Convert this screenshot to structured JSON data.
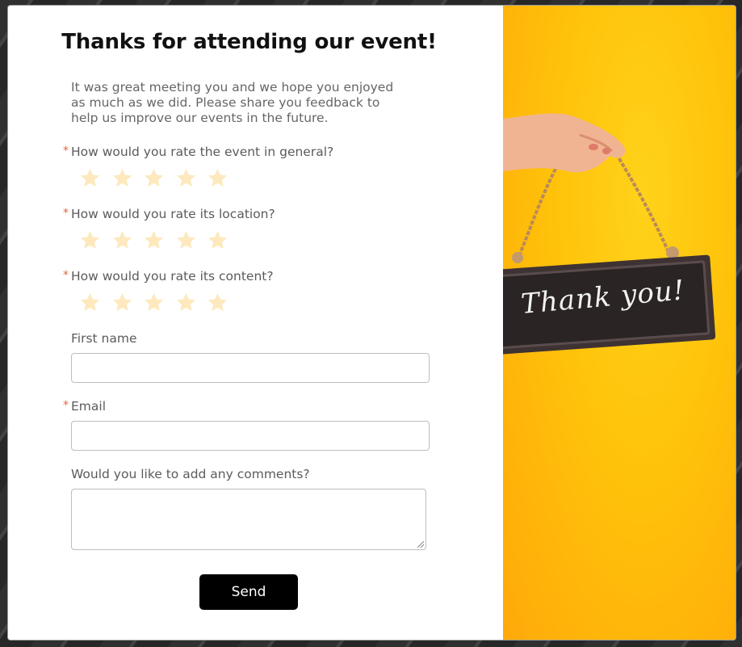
{
  "form": {
    "title": "Thanks for attending our event!",
    "intro": "It was great meeting you and we hope you enjoyed as much as we did. Please share you feedback to help us improve our events in the future.",
    "required_mark": "*",
    "questions": [
      {
        "label": "How would you rate the event in general?",
        "required": true,
        "rating": 0,
        "max": 5
      },
      {
        "label": "How would you rate its location?",
        "required": true,
        "rating": 0,
        "max": 5
      },
      {
        "label": "How would you rate its content?",
        "required": true,
        "rating": 0,
        "max": 5
      }
    ],
    "first_name": {
      "label": "First name",
      "value": "",
      "placeholder": ""
    },
    "email": {
      "label": "Email",
      "required": true,
      "value": "",
      "placeholder": ""
    },
    "comments": {
      "label": "Would you like to add any comments?",
      "value": ""
    },
    "send_label": "Send"
  },
  "image_panel": {
    "sign_text": "Thank you!",
    "background_color": "#ffc20a"
  },
  "colors": {
    "star_empty": "#fde9bd",
    "required": "#e8643c",
    "button": "#000000"
  }
}
